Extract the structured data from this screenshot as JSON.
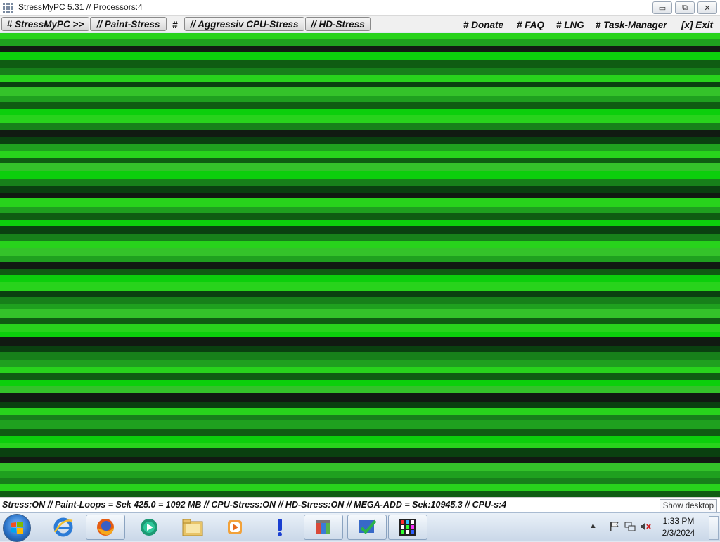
{
  "window": {
    "title": "StressMyPC 5.31 // Processors:4",
    "controls": {
      "minimize": "▭",
      "maximize": "⧉",
      "close": "✕"
    }
  },
  "menu": {
    "stressmypc": "# StressMyPC >>",
    "paint_stress": "// Paint-Stress",
    "hash": "#",
    "aggressive_cpu": "// Aggressiv CPU-Stress",
    "hd_stress": "// HD-Stress",
    "donate": "# Donate",
    "faq": "# FAQ",
    "lng": "# LNG",
    "task_manager": "# Task-Manager",
    "exit": "[x] Exit"
  },
  "stress_area": {
    "palette": [
      "#1fa01f",
      "#0f5c12",
      "#28d31c",
      "#111a12",
      "#17801a",
      "#0ccf0c",
      "#0a4010",
      "#34c22a"
    ]
  },
  "status": {
    "text": "Stress:ON // Paint-Loops = Sek 425.0 = 1092 MB // CPU-Stress:ON // HD-Stress:ON // MEGA-ADD = Sek:10945.3 // CPU-s:4",
    "show_desktop": "Show desktop"
  },
  "taskbar": {
    "items": [
      {
        "name": "internet-explorer-icon"
      },
      {
        "name": "firefox-icon"
      },
      {
        "name": "media-center-icon"
      },
      {
        "name": "file-explorer-icon"
      },
      {
        "name": "media-player-icon"
      },
      {
        "name": "alert-icon"
      },
      {
        "name": "colored-files-icon"
      },
      {
        "name": "checkmark-app-icon"
      },
      {
        "name": "stressmypc-icon"
      }
    ],
    "clock_time": "1:33 PM",
    "clock_date": "2/3/2024"
  }
}
